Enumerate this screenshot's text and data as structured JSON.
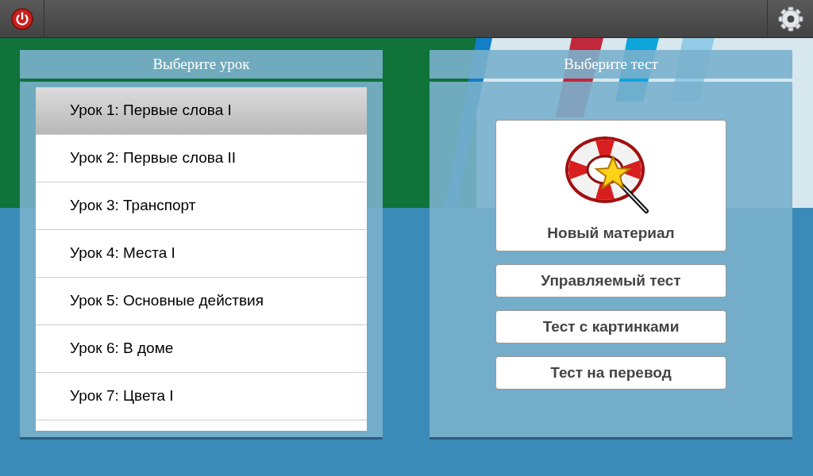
{
  "lessons_panel": {
    "title": "Выберите урок",
    "items": [
      {
        "label": "Урок 1: Первые слова I",
        "selected": true
      },
      {
        "label": "Урок 2: Первые слова II",
        "selected": false
      },
      {
        "label": "Урок 3: Транспорт",
        "selected": false
      },
      {
        "label": "Урок 4: Места I",
        "selected": false
      },
      {
        "label": "Урок 5: Основные действия",
        "selected": false
      },
      {
        "label": "Урок 6: В доме",
        "selected": false
      },
      {
        "label": "Урок 7: Цвета I",
        "selected": false
      }
    ]
  },
  "tests_panel": {
    "title": "Выберите тест",
    "buttons": [
      {
        "kind": "featured",
        "label": "Новый материал"
      },
      {
        "kind": "plain",
        "label": "Управляемый тест"
      },
      {
        "kind": "plain",
        "label": "Тест с картинками"
      },
      {
        "kind": "plain",
        "label": "Тест на перевод"
      }
    ]
  }
}
